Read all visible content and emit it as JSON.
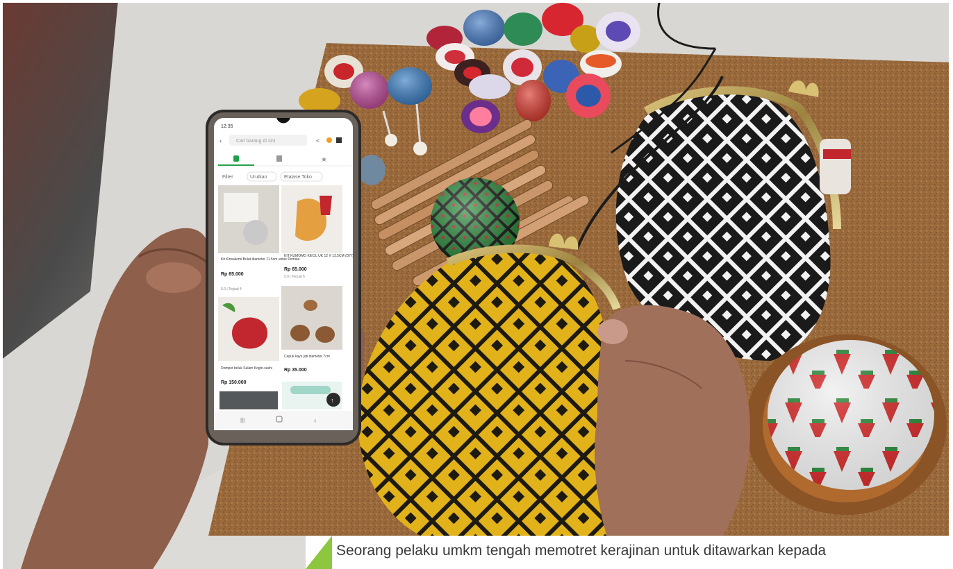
{
  "caption": {
    "text": "Seorang pelaku umkm tengah memotret kerajinan untuk ditawarkan kepada",
    "accent_color": "#8dc63f"
  },
  "phone": {
    "status_time": "12:35",
    "search_placeholder": "Cari barang di sini",
    "filters": {
      "filter_label": "Filter",
      "sort_label": "Urutkan",
      "showcase_label": "Etalase Toko"
    },
    "products": [
      {
        "name": "Kit Kinsakomi Bulat diameter 11.5cm untuk Pemula",
        "price": "Rp 65.000",
        "rating": "5.0 | Terjual 4"
      },
      {
        "name": "KIT KUMOMO KECIL UK 12 X 13.5CM (DIY)",
        "price": "Rp 65.000",
        "rating": "5.0 | Terjual 6"
      },
      {
        "name": "Dompet beluk Sulam Kogin-sashi",
        "price": "Rp 150.000",
        "rating": ""
      },
      {
        "name": "Cepuk kayu jati diameter 7cm",
        "price": "Rp 35.000",
        "rating": ""
      }
    ]
  }
}
